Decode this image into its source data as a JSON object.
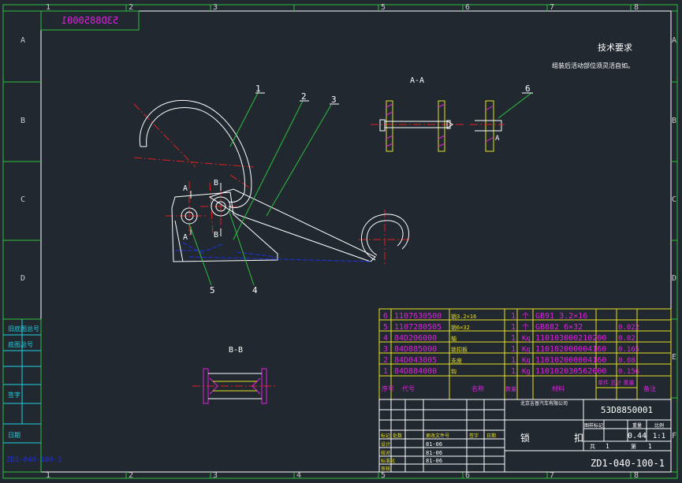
{
  "drawing": {
    "stamp_code": "53D8850001",
    "tech_title": "技术要求",
    "tech_text": "组装后活动部位须灵活自如。",
    "section_aa": "A-A",
    "section_bb": "B-B",
    "drawing_no": "ZD1-040-100-1",
    "part_code": "53D8850001",
    "weight": "0.44",
    "scale": "1:1",
    "sheet_total": "1",
    "sheet_no": "1",
    "side_code": "ZD1-040-100-1"
  },
  "frame": {
    "cols": [
      "1",
      "2",
      "3",
      "4",
      "5",
      "6",
      "7",
      "8"
    ],
    "rows": [
      "A",
      "B",
      "C",
      "D",
      "E",
      "F"
    ]
  },
  "callouts": {
    "c1": "1",
    "c2": "2",
    "c3": "3",
    "c4": "4",
    "c5": "5",
    "c6": "6",
    "secA1": "A",
    "secA2": "A",
    "secA3": "A",
    "secB1": "B",
    "secB2": "B"
  },
  "bom": [
    {
      "no": "6",
      "code": "1107630500",
      "name": "销3.2×16",
      "qty": "1",
      "unit": "个",
      "std": "GB91 3.2×16",
      "mat": "",
      "wt": "",
      "note": ""
    },
    {
      "no": "5",
      "code": "1107280505",
      "name": "销6×32",
      "qty": "1",
      "unit": "个",
      "std": "GB882 6×32",
      "mat": "",
      "wt": "0.022",
      "note": ""
    },
    {
      "no": "4",
      "code": "84D206000",
      "name": "轴",
      "qty": "1",
      "unit": "Kg",
      "std": "110103000210200",
      "mat": "",
      "wt": "0.02",
      "note": ""
    },
    {
      "no": "3",
      "code": "84D885000",
      "name": "锁扣板",
      "qty": "1",
      "unit": "Kg",
      "std": "110102000004160",
      "mat": "",
      "wt": "0.165",
      "note": ""
    },
    {
      "no": "2",
      "code": "84D043005",
      "name": "支座",
      "qty": "1",
      "unit": "Kg",
      "std": "110102000004160",
      "mat": "",
      "wt": "0.08",
      "note": ""
    },
    {
      "no": "1",
      "code": "84D884000",
      "name": "钩",
      "qty": "1",
      "unit": "Kg",
      "std": "110102030562000",
      "mat": "",
      "wt": "0.156",
      "note": ""
    }
  ],
  "bom_header": {
    "no": "序号",
    "code": "代号",
    "name": "名称",
    "qty": "数量",
    "mat": "材料",
    "wt": "单件 总计 重量",
    "note": "备注"
  },
  "title_block": {
    "company": "北京吉普汽车有限公司",
    "name": "锁",
    "name2": "扣",
    "roles": [
      "设计",
      "校对",
      "标准化",
      "审核",
      "批准"
    ],
    "dates": [
      "81-06",
      "81-06",
      "81-06"
    ],
    "labels": [
      "标记",
      "处数",
      "更改文件号",
      "签字",
      "日期"
    ],
    "col_heads": [
      "图样标记",
      "重量",
      "比例"
    ],
    "sheet_label": "共",
    "sheet_label2": "第"
  },
  "side_panel": {
    "items": [
      "旧底图总号",
      "底图总号",
      "签字",
      "日期"
    ]
  }
}
